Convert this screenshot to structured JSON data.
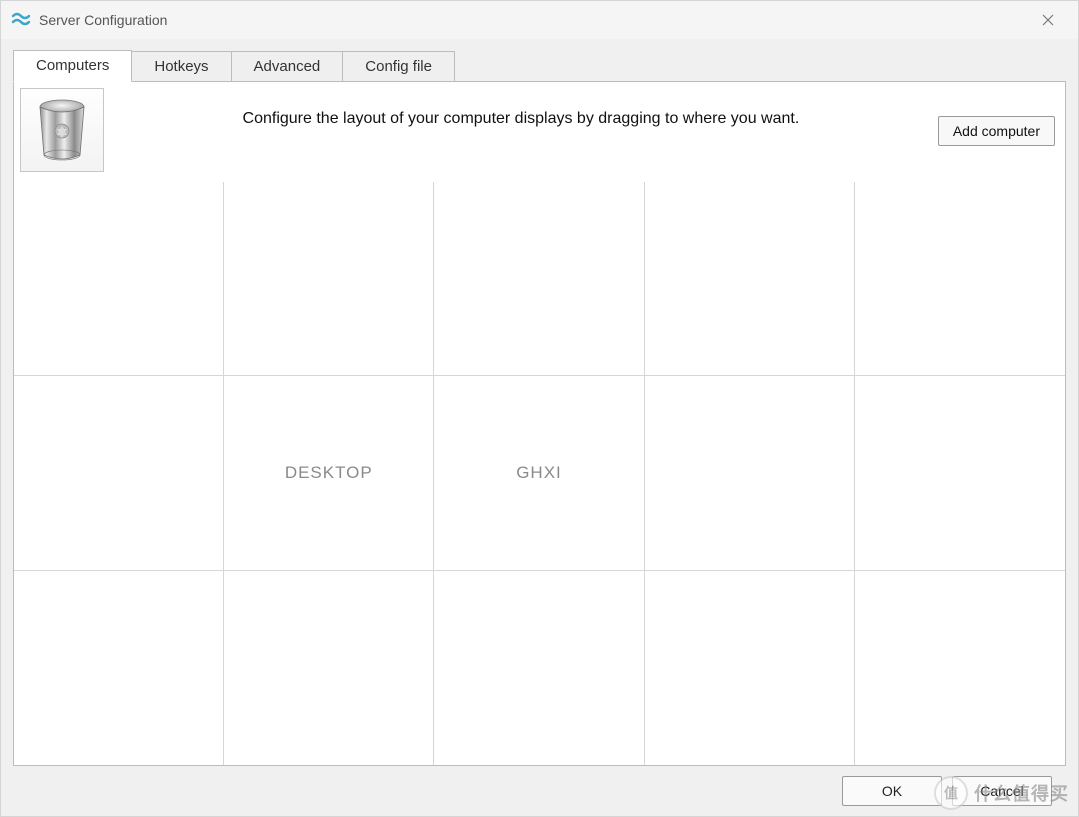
{
  "window": {
    "title": "Server Configuration"
  },
  "tabs": [
    {
      "label": "Computers",
      "active": true
    },
    {
      "label": "Hotkeys",
      "active": false
    },
    {
      "label": "Advanced",
      "active": false
    },
    {
      "label": "Config file",
      "active": false
    }
  ],
  "panel": {
    "instruction": "Configure the layout of your computer displays by dragging to where you want.",
    "add_button": "Add computer"
  },
  "grid": {
    "rows": 3,
    "cols": 5,
    "cells": [
      {
        "row": 1,
        "col": 1,
        "label": "DESKTOP"
      },
      {
        "row": 1,
        "col": 2,
        "label": "GHXI"
      }
    ]
  },
  "footer": {
    "ok": "OK",
    "cancel": "Cancel"
  },
  "watermark": {
    "badge": "值",
    "text": "什么值得买"
  }
}
